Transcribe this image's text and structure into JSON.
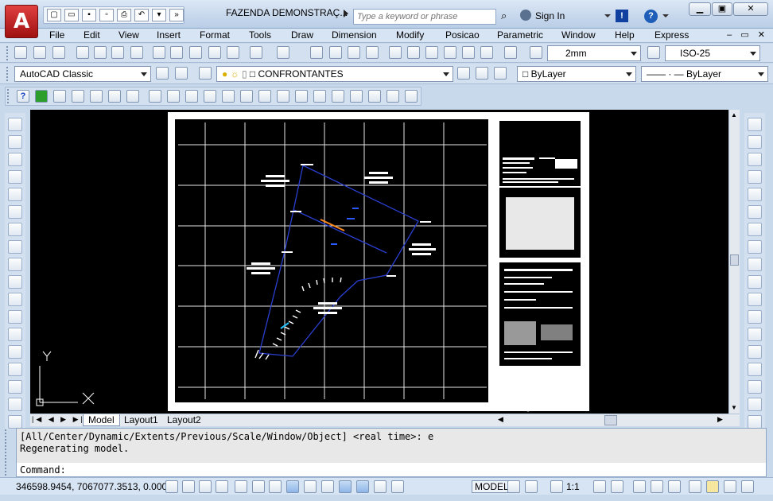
{
  "titlebar": {
    "logo_letter": "A",
    "document_title": "FAZENDA DEMONSTRAÇ...",
    "search_placeholder": "Type a keyword or phrase",
    "sign_in": "Sign In"
  },
  "menus": [
    "File",
    "Edit",
    "View",
    "Insert",
    "Format",
    "Tools",
    "Draw",
    "Dimension",
    "Modify",
    "Posicao",
    "Parametric",
    "Window",
    "Help",
    "Express"
  ],
  "toolbar": {
    "text_style": "2mm",
    "dim_style": "ISO-25",
    "workspace": "AutoCAD Classic",
    "layer": "CONFRONTANTES",
    "color": "ByLayer",
    "linetype": "ByLayer"
  },
  "layout_tabs": [
    "Model",
    "Layout1",
    "Layout2"
  ],
  "ucs": {
    "y_label": "Y",
    "x_label": "X"
  },
  "command": {
    "history": [
      "[All/Center/Dynamic/Extents/Previous/Scale/Window/Object] <real time>: e",
      "Regenerating model."
    ],
    "prompt": "Command:"
  },
  "status": {
    "coordinates": "346598.9454, 7067077.3513, 0.0000",
    "space": "MODEL",
    "annotation_scale": "1:1"
  },
  "colors": {
    "canvas": "#000000",
    "parcel_line": "#2a3fd0",
    "highlight_line": "#ff8a1e",
    "ui_chrome": "#d3e0f0"
  }
}
